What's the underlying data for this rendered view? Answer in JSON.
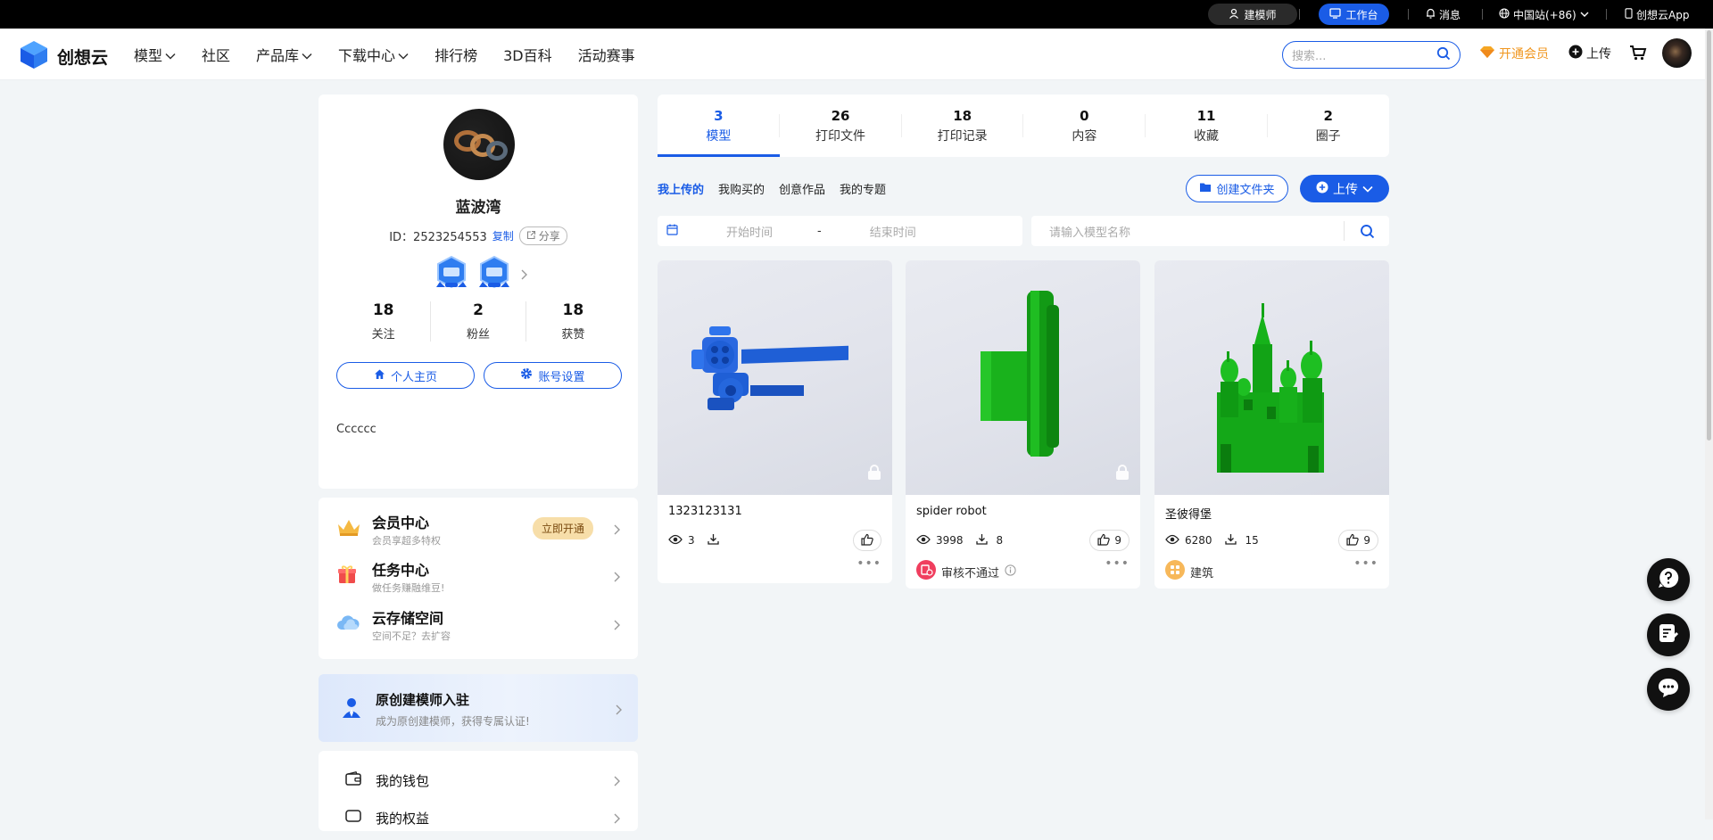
{
  "topbar": {
    "modeler": "建模师",
    "workbench": "工作台",
    "messages": "消息",
    "region": "中国站(+86)",
    "app": "创想云App"
  },
  "nav": {
    "logo": "创想云",
    "items": [
      "模型",
      "社区",
      "产品库",
      "下载中心",
      "排行榜",
      "3D百科",
      "活动赛事"
    ],
    "search_placeholder": "搜索...",
    "vip": "开通会员",
    "upload": "上传"
  },
  "profile": {
    "name": "蓝波湾",
    "id": "ID：2523254553",
    "copy": "复制",
    "share": "分享",
    "stats": [
      {
        "num": "18",
        "label": "关注"
      },
      {
        "num": "2",
        "label": "粉丝"
      },
      {
        "num": "18",
        "label": "获赞"
      }
    ],
    "home_btn": "个人主页",
    "settings_btn": "账号设置",
    "bio": "Cccccc"
  },
  "services": [
    {
      "title": "会员中心",
      "sub": "会员享超多特权",
      "action": "立即开通"
    },
    {
      "title": "任务中心",
      "sub": "做任务赚融维豆!"
    },
    {
      "title": "云存储空间",
      "sub": "空间不足？去扩容"
    }
  ],
  "creator": {
    "title": "原创建模师入驻",
    "sub": "成为原创建模师，获得专属认证!"
  },
  "wallet": {
    "title": "我的钱包",
    "next": "我的权益"
  },
  "tabs": [
    {
      "num": "3",
      "label": "模型"
    },
    {
      "num": "26",
      "label": "打印文件"
    },
    {
      "num": "18",
      "label": "打印记录"
    },
    {
      "num": "0",
      "label": "内容"
    },
    {
      "num": "11",
      "label": "收藏"
    },
    {
      "num": "2",
      "label": "圈子"
    }
  ],
  "subtabs": [
    "我上传的",
    "我购买的",
    "创意作品",
    "我的专题"
  ],
  "actions": {
    "create_folder": "创建文件夹",
    "upload": "上传"
  },
  "filters": {
    "start": "开始时间",
    "sep": "-",
    "end": "结束时间",
    "name_placeholder": "请输入模型名称"
  },
  "models": [
    {
      "name": "1323123131",
      "views": "3",
      "downloads": "",
      "likes": "",
      "footer": ""
    },
    {
      "name": "spider robot",
      "views": "3998",
      "downloads": "8",
      "likes": "9",
      "footer": "审核不通过"
    },
    {
      "name": "圣彼得堡",
      "views": "6280",
      "downloads": "15",
      "likes": "9",
      "footer": "建筑"
    }
  ],
  "colors": {
    "accent": "#1a5ce6",
    "vip": "#f0961e",
    "model_blue": "#1f5fd6",
    "model_green": "#16b21a"
  }
}
